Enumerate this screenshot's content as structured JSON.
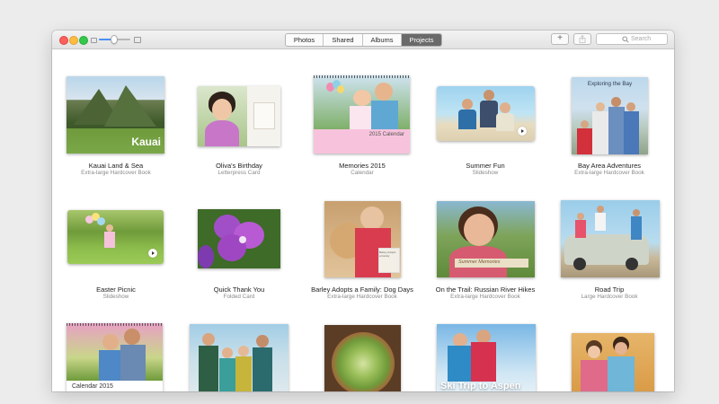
{
  "toolbar": {
    "tabs": [
      {
        "label": "Photos",
        "active": false
      },
      {
        "label": "Shared",
        "active": false
      },
      {
        "label": "Albums",
        "active": false
      },
      {
        "label": "Projects",
        "active": true
      }
    ],
    "add_button": "+",
    "share_icon": "share-icon",
    "search_placeholder": "Search",
    "zoom_level": 0.45
  },
  "rows": [
    {
      "items": [
        {
          "title": "Kauai Land & Sea",
          "subtitle": "Extra-large Hardcover Book",
          "cover_text": "Kauai"
        },
        {
          "title": "Oliva's Birthday",
          "subtitle": "Letterpress Card"
        },
        {
          "title": "Memories 2015",
          "subtitle": "Calendar",
          "cover_text": "2015 Calendar"
        },
        {
          "title": "Summer Fun",
          "subtitle": "Slideshow"
        },
        {
          "title": "Bay Area Adventures",
          "subtitle": "Extra-large Hardcover Book",
          "cover_text": "Exploring the Bay"
        }
      ]
    },
    {
      "items": [
        {
          "title": "Easter Picnic",
          "subtitle": "Slideshow"
        },
        {
          "title": "Quick Thank You",
          "subtitle": "Folded Card"
        },
        {
          "title": "Barley Adopts a Family: Dog Days",
          "subtitle": "Extra-large Hardcover Book",
          "cover_text": "Barley Adopts a Family"
        },
        {
          "title": "On the Trail: Russian River Hikes",
          "subtitle": "Extra-large Hardcover Book",
          "cover_text": "Summer Memories"
        },
        {
          "title": "Road Trip",
          "subtitle": "Large Hardcover Book"
        }
      ]
    },
    {
      "items": [
        {
          "cover_text": "Calendar 2015"
        },
        {},
        {},
        {
          "cover_text": "Ski Trip to Aspen"
        },
        {}
      ]
    }
  ]
}
